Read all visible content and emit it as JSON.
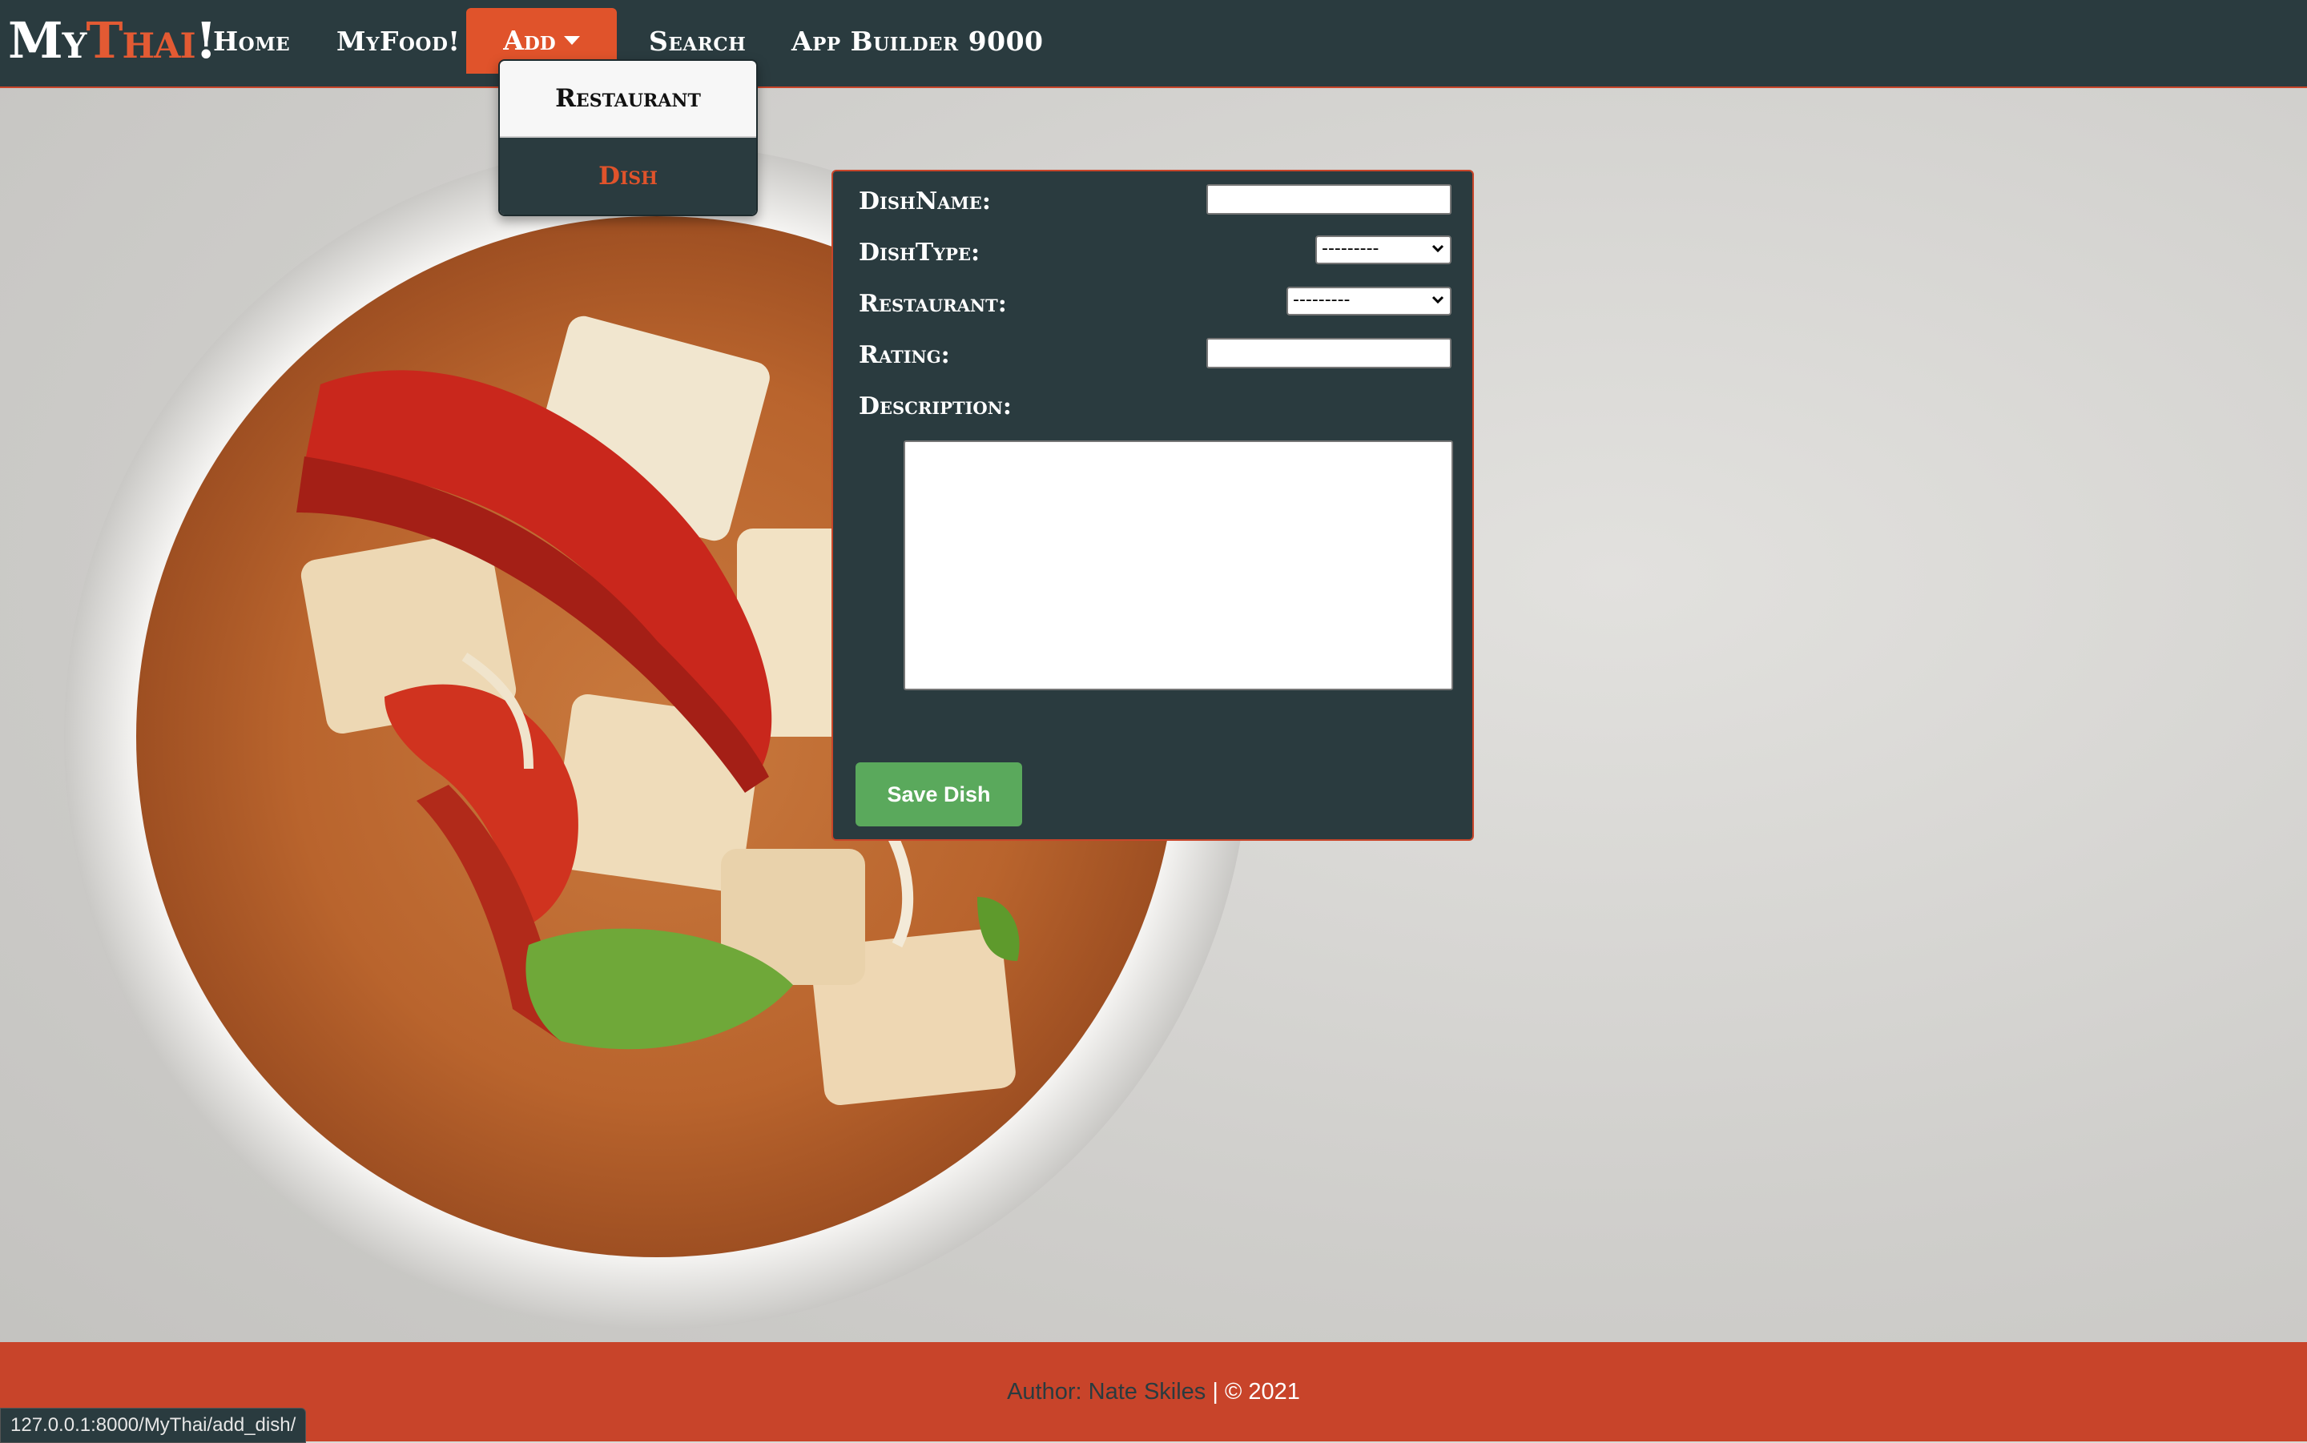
{
  "brand": {
    "prefix": "My",
    "accent": "Thai",
    "suffix": "!"
  },
  "nav": {
    "home": "Home",
    "myfood": "MyFood!",
    "add": "Add",
    "search": "Search",
    "app_builder": "App Builder 9000"
  },
  "dropdown": {
    "items": [
      {
        "label": "Restaurant"
      },
      {
        "label": "Dish"
      }
    ]
  },
  "form": {
    "dish_name_label": "DishName:",
    "dish_name_value": "",
    "dish_type_label": "DishType:",
    "dish_type_selected": "---------",
    "restaurant_label": "Restaurant:",
    "restaurant_selected": "---------",
    "rating_label": "Rating:",
    "rating_value": "",
    "description_label": "Description:",
    "description_value": "",
    "save_label": "Save Dish"
  },
  "footer": {
    "author_text": "Author: Nate Skiles",
    "separator": " | ",
    "copyright": "© 2021"
  },
  "status_bar": {
    "url": "127.0.0.1:8000/MyThai/add_dish/"
  },
  "colors": {
    "navbar_bg": "#2a3b3f",
    "accent_orange": "#e0532b",
    "footer_bg": "#c8442a",
    "save_green": "#5aa95c"
  }
}
